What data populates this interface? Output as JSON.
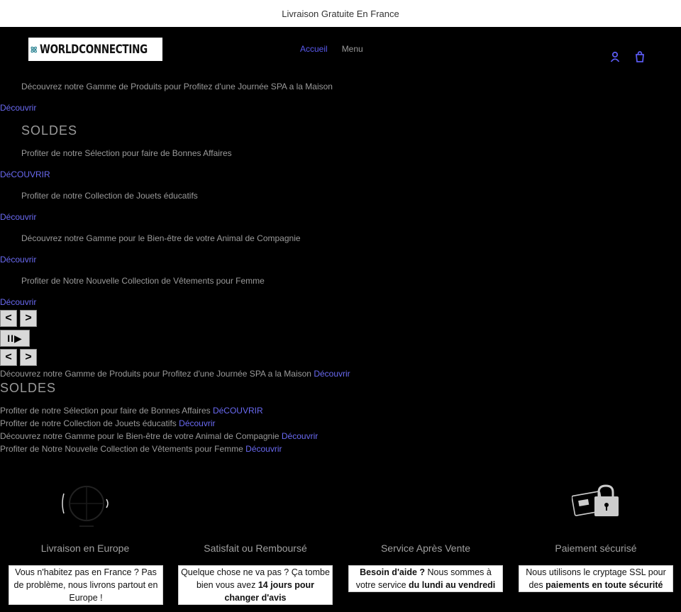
{
  "announcement": "Livraison Gratuite En France",
  "logo": {
    "text": "WORLDCONNECTING"
  },
  "nav": {
    "items": [
      "Accueil",
      "Menu"
    ]
  },
  "slides": [
    {
      "text": "Découvrez notre Gamme de Produits pour Profitez d'une Journée SPA a la Maison",
      "link": "Découvrir"
    },
    {
      "heading": "SOLDES",
      "text": "Profiter de notre Sélection pour faire de Bonnes Affaires",
      "link": "DéCOUVRIR"
    },
    {
      "text": "Profiter de notre Collection de Jouets éducatifs",
      "link": "Découvrir"
    },
    {
      "text": "Découvrez notre Gamme pour le Bien-être de votre Animal de Compagnie",
      "link": "Découvrir"
    },
    {
      "text": "Profiter de Notre Nouvelle Collection de Vêtements pour Femme",
      "link": "Découvrir"
    }
  ],
  "controls": {
    "prev": "<",
    "next": ">",
    "pause": "II▶"
  },
  "features": [
    {
      "title": "Livraison en Europe",
      "icon": "globe-icon",
      "body": [
        "Vous n'habitez pas en France ? Pas de problème, nous livrons partout en Europe !"
      ]
    },
    {
      "title": "Satisfait ou Remboursé",
      "icon": "none",
      "body_pre": "Quelque chose ne va pas ? Ça tombe bien vous avez ",
      "body_bold": "14 jours pour changer d'avis",
      "body_post": ""
    },
    {
      "title": "Service Après Vente",
      "icon": "none",
      "body_bold1": "Besoin d'aide ?",
      "body_mid": " Nous sommes à votre service ",
      "body_bold2": "du lundi au vendredi"
    },
    {
      "title": "Paiement sécurisé",
      "icon": "padlock-card-icon",
      "body_pre": "Nous utilisons le cryptage SSL pour des ",
      "body_bold": "paiements en toute sécurité"
    }
  ]
}
